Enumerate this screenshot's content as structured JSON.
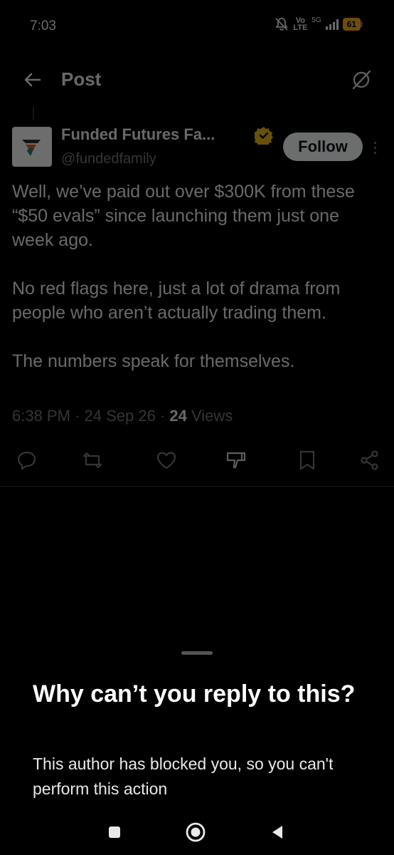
{
  "status_bar": {
    "time": "7:03",
    "volte_top": "Vo",
    "volte_bottom": "LTE",
    "network": "5G",
    "battery": "61",
    "battery_color": "#f5a623"
  },
  "header": {
    "title": "Post",
    "back_icon": "arrow-left-icon",
    "grok_icon": "grok-icon"
  },
  "post": {
    "author_name": "Funded Futures Fa...",
    "handle": "@fundedfamily",
    "follow_label": "Follow",
    "paragraphs": [
      "Well, we’ve paid out over $300K from these “$50 evals” since launching them just one week ago.",
      "No red flags here, just a lot of drama from people who aren’t actually trading them.",
      "The numbers speak for themselves."
    ],
    "time": "6:38 PM",
    "date": "24 Sep 26",
    "views_count": "24",
    "views_label": "Views",
    "separator": "·",
    "verified_color": "#e2b719"
  },
  "actions": [
    "reply-icon",
    "repost-icon",
    "like-icon",
    "dislike-icon",
    "bookmark-icon",
    "share-icon"
  ],
  "sheet": {
    "title": "Why can’t you reply to this?",
    "body": "This author has blocked you, so you can't perform this action"
  },
  "nav_bar": [
    "recents-icon",
    "home-icon",
    "back-icon"
  ]
}
